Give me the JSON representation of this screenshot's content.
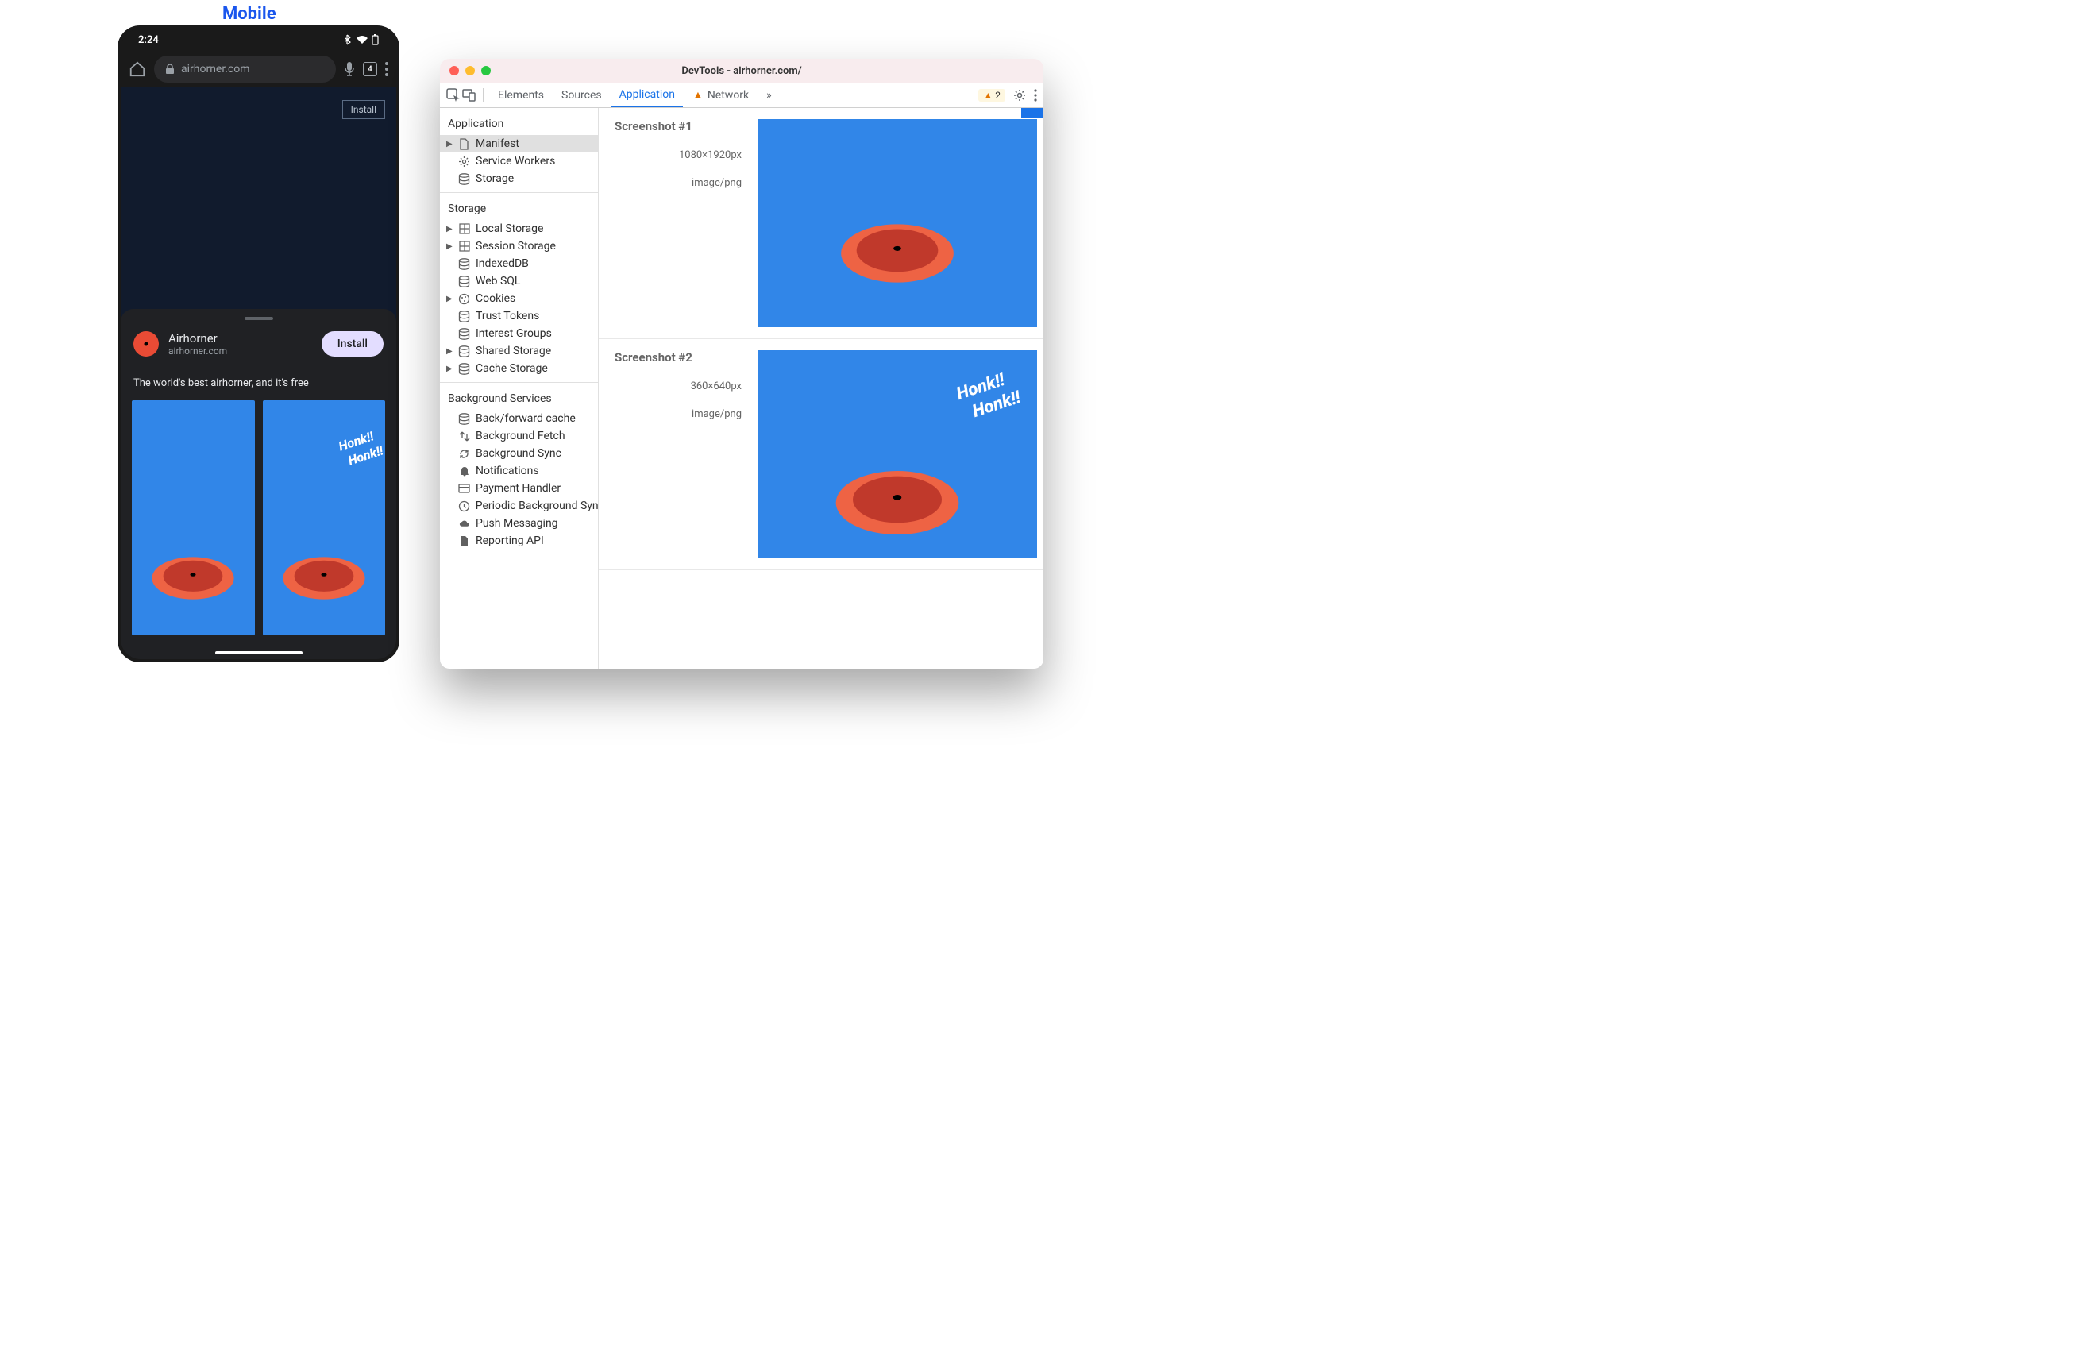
{
  "label": "Mobile",
  "phone": {
    "time": "2:24",
    "url": "airhorner.com",
    "tabCount": "4",
    "installChip": "Install",
    "sheet": {
      "appName": "Airhorner",
      "appDomain": "airhorner.com",
      "installBtn": "Install",
      "description": "The world's best airhorner, and it's free",
      "honk": "Honk!!"
    }
  },
  "devtools": {
    "title": "DevTools - airhorner.com/",
    "tabs": {
      "elements": "Elements",
      "sources": "Sources",
      "application": "Application",
      "network": "Network"
    },
    "warnCount": "2",
    "sidebar": {
      "appHeading": "Application",
      "manifest": "Manifest",
      "sw": "Service Workers",
      "storage": "Storage",
      "storageHeading": "Storage",
      "local": "Local Storage",
      "session": "Session Storage",
      "idb": "IndexedDB",
      "websql": "Web SQL",
      "cookies": "Cookies",
      "trust": "Trust Tokens",
      "interest": "Interest Groups",
      "shared": "Shared Storage",
      "cache": "Cache Storage",
      "bgHeading": "Background Services",
      "bfcache": "Back/forward cache",
      "bgfetch": "Background Fetch",
      "bgsync": "Background Sync",
      "notif": "Notifications",
      "payment": "Payment Handler",
      "periodic": "Periodic Background Sync",
      "push": "Push Messaging",
      "reporting": "Reporting API"
    },
    "content": {
      "sc1": {
        "title": "Screenshot #1",
        "dim": "1080×1920px",
        "mime": "image/png"
      },
      "sc2": {
        "title": "Screenshot #2",
        "dim": "360×640px",
        "mime": "image/png",
        "honk": "Honk!!"
      }
    }
  }
}
